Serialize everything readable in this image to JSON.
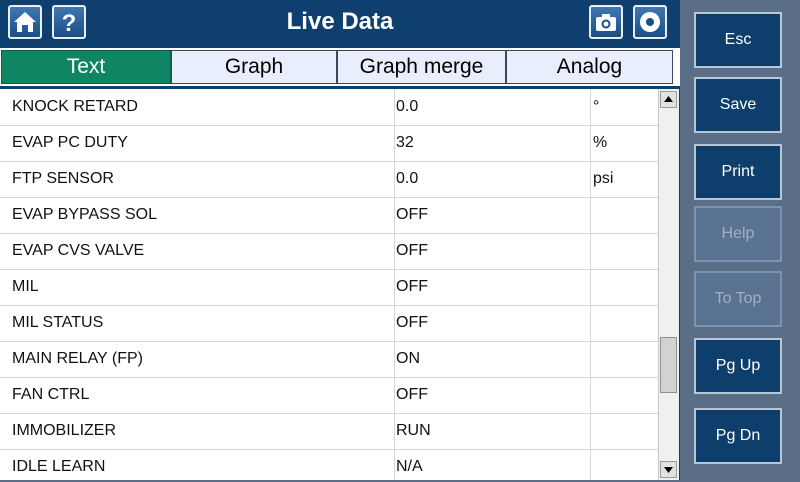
{
  "header": {
    "title": "Live Data",
    "home_icon": "home-icon",
    "help_icon": "help-icon",
    "camera_icon": "camera-icon",
    "record_icon": "record-icon"
  },
  "tabs": [
    {
      "label": "Text",
      "active": true
    },
    {
      "label": "Graph",
      "active": false
    },
    {
      "label": "Graph merge",
      "active": false
    },
    {
      "label": "Analog",
      "active": false
    }
  ],
  "rows": [
    {
      "name": "KNOCK RETARD",
      "value": "0.0",
      "unit": "°"
    },
    {
      "name": "EVAP PC DUTY",
      "value": "32",
      "unit": "%"
    },
    {
      "name": "FTP SENSOR",
      "value": "0.0",
      "unit": "psi"
    },
    {
      "name": "EVAP BYPASS SOL",
      "value": "OFF",
      "unit": ""
    },
    {
      "name": "EVAP CVS VALVE",
      "value": "OFF",
      "unit": ""
    },
    {
      "name": "MIL",
      "value": "OFF",
      "unit": ""
    },
    {
      "name": "MIL STATUS",
      "value": "OFF",
      "unit": ""
    },
    {
      "name": "MAIN RELAY (FP)",
      "value": "ON",
      "unit": ""
    },
    {
      "name": "FAN CTRL",
      "value": "OFF",
      "unit": ""
    },
    {
      "name": "IMMOBILIZER",
      "value": "RUN",
      "unit": ""
    },
    {
      "name": "IDLE LEARN",
      "value": "N/A",
      "unit": ""
    }
  ],
  "side_buttons": [
    {
      "label": "Esc",
      "enabled": true
    },
    {
      "label": "Save",
      "enabled": true
    },
    {
      "label": "Print",
      "enabled": true
    },
    {
      "label": "Help",
      "enabled": false
    },
    {
      "label": "To Top",
      "enabled": false
    },
    {
      "label": "Pg Up",
      "enabled": true
    },
    {
      "label": "Pg Dn",
      "enabled": true
    }
  ],
  "colors": {
    "header_bg": "#0f3f6e",
    "active_tab": "#0f8563",
    "side_panel": "#5b6e87"
  }
}
